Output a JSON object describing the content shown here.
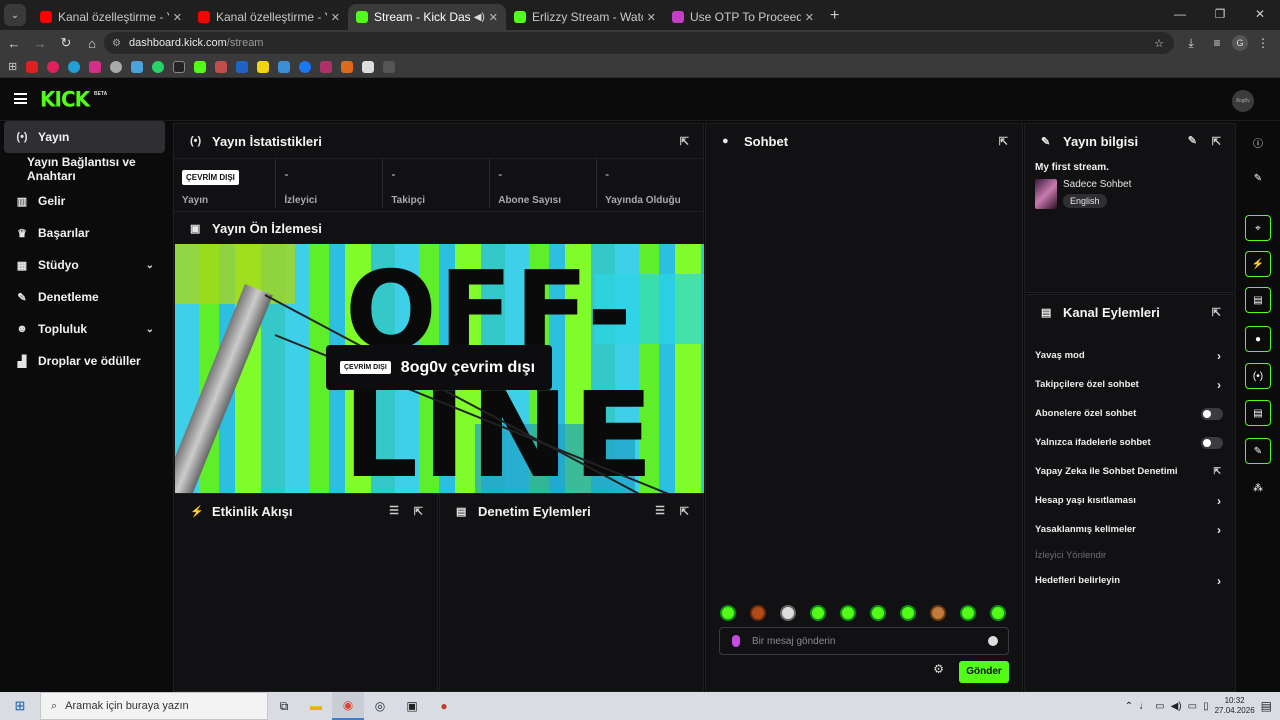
{
  "browser": {
    "tabs": [
      {
        "title": "Kanal özelleştirme - YouTube St",
        "color": "#ff0000",
        "active": false
      },
      {
        "title": "Kanal özelleştirme - YouTube St",
        "color": "#ff0000",
        "active": false
      },
      {
        "title": "Stream - Kick Dashboard",
        "color": "#53fc18",
        "active": true
      },
      {
        "title": "Erlizzy Stream - Watch Live on K",
        "color": "#53fc18",
        "active": false
      },
      {
        "title": "Use OTP To Proceed - gkhanyilr",
        "color": "#c43fc3",
        "active": false
      }
    ],
    "url_host": "dashboard.kick.com",
    "url_path": "/stream"
  },
  "header": {
    "logo": "KICK",
    "beta": "BETA",
    "profile_initials": "8og0v"
  },
  "sidebar": {
    "items": [
      {
        "label": "Yayın",
        "icon": "broadcast-icon",
        "glyph": "(•)"
      },
      {
        "label": "Yayın Bağlantısı ve Anahtarı"
      },
      {
        "label": "Gelir",
        "icon": "chart-icon",
        "glyph": "▥"
      },
      {
        "label": "Başarılar",
        "icon": "trophy-icon",
        "glyph": "♛"
      },
      {
        "label": "Stüdyo",
        "icon": "studio-icon",
        "glyph": "▦"
      },
      {
        "label": "Denetleme",
        "icon": "wrench-icon",
        "glyph": "✎"
      },
      {
        "label": "Topluluk",
        "icon": "community-icon",
        "glyph": "☻"
      },
      {
        "label": "Droplar ve ödüller",
        "icon": "drops-icon",
        "glyph": "▟"
      }
    ]
  },
  "stats": {
    "title": "Yayın İstatistikleri",
    "status_badge": "ÇEVRİM DIŞI",
    "items": [
      {
        "value": "",
        "label": "Yayın"
      },
      {
        "value": "-",
        "label": "İzleyici"
      },
      {
        "value": "-",
        "label": "Takipçi"
      },
      {
        "value": "-",
        "label": "Abone Sayısı"
      },
      {
        "value": "-",
        "label": "Yayında Olduğu"
      }
    ]
  },
  "preview": {
    "title": "Yayın Ön İzlemesi",
    "bg_text_1": "OFF-",
    "bg_text_2": "LINE",
    "badge": "ÇEVRİM DIŞI",
    "message": "8og0v çevrim dışı"
  },
  "activity": {
    "title": "Etkinlik Akışı"
  },
  "moderation": {
    "title": "Denetim Eylemleri"
  },
  "chat": {
    "title": "Sohbet",
    "placeholder": "Bir mesaj gönderin",
    "send_label": "Gönder",
    "emote_count": 10
  },
  "stream_info": {
    "title": "Yayın bilgisi",
    "stream_title": "My first stream.",
    "category": "Sadece Sohbet",
    "language": "English"
  },
  "channel_actions": {
    "title": "Kanal Eylemleri",
    "items": [
      {
        "label": "Yavaş mod",
        "control": "arrow"
      },
      {
        "label": "Takipçilere özel sohbet",
        "control": "arrow"
      },
      {
        "label": "Abonelere özel sohbet",
        "control": "toggle"
      },
      {
        "label": "Yalnızca ifadelerle sohbet",
        "control": "toggle"
      },
      {
        "label": "Yapay Zeka ile Sohbet Denetimi",
        "control": "external"
      },
      {
        "label": "Hesap yaşı kısıtlaması",
        "control": "arrow"
      },
      {
        "label": "Yasaklanmış kelimeler",
        "control": "arrow"
      },
      {
        "label": "İzleyici Yönlendir",
        "control": "none",
        "disabled": true
      },
      {
        "label": "Hedefleri belirleyin",
        "control": "arrow"
      }
    ]
  },
  "taskbar": {
    "search_placeholder": "Aramak için buraya yazın",
    "time": "10:32",
    "date": "27.04.2026"
  },
  "colors": {
    "accent": "#53fc18",
    "panel": "#111113",
    "background": "#0b0b0c"
  }
}
